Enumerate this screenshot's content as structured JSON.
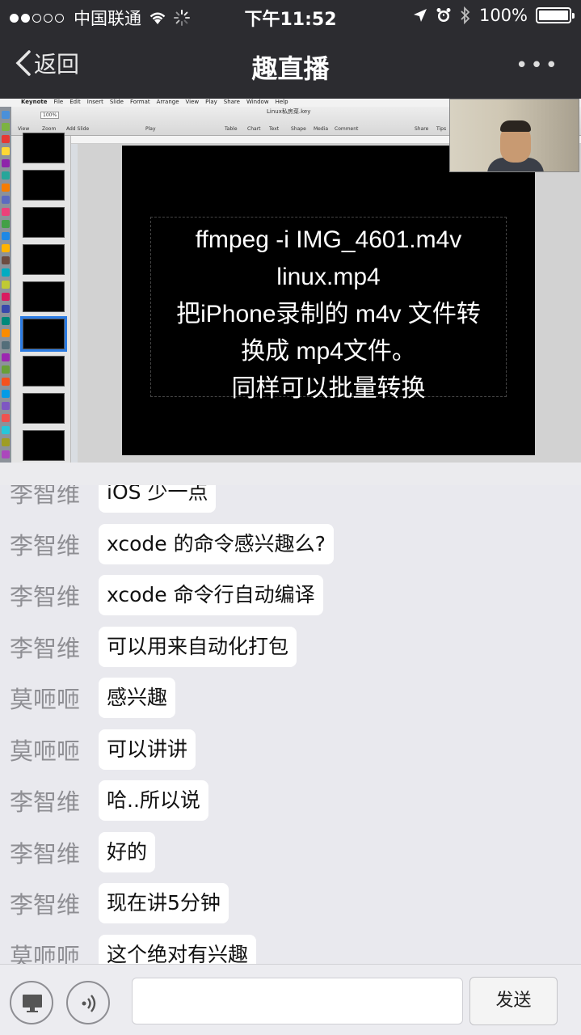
{
  "status_bar": {
    "carrier": "中国联通",
    "time": "下午11:52",
    "battery": "100%",
    "signal_bars_filled": 2,
    "signal_bars_total": 5,
    "battery_level": 1.0
  },
  "nav": {
    "back_label": "返回",
    "title": "趣直播",
    "more": "•••"
  },
  "video": {
    "app_menu": [
      "Keynote",
      "File",
      "Edit",
      "Insert",
      "Slide",
      "Format",
      "Arrange",
      "View",
      "Play",
      "Share",
      "Window",
      "Help"
    ],
    "doc_title": "Linux私房菜.key",
    "toolbar_items": [
      "View",
      "Zoom",
      "Add Slide",
      "Play",
      "Table",
      "Chart",
      "Text",
      "Shape",
      "Media",
      "Comment",
      "Share",
      "Tips"
    ],
    "zoom": "100%",
    "slide_lines": [
      "ffmpeg -i IMG_4601.m4v",
      "linux.mp4",
      "把iPhone录制的 m4v 文件转",
      "换成 mp4文件。",
      "同样可以批量转换"
    ]
  },
  "chat": {
    "messages": [
      {
        "sender": "李智维",
        "text": "iOS 少一点"
      },
      {
        "sender": "李智维",
        "text": "xcode 的命令感兴趣么?"
      },
      {
        "sender": "李智维",
        "text": "xcode 命令行自动编译"
      },
      {
        "sender": "李智维",
        "text": "可以用来自动化打包"
      },
      {
        "sender": "莫咂咂",
        "text": "感兴趣"
      },
      {
        "sender": "莫咂咂",
        "text": "可以讲讲"
      },
      {
        "sender": "李智维",
        "text": "哈..所以说"
      },
      {
        "sender": "李智维",
        "text": "好的"
      },
      {
        "sender": "李智维",
        "text": "现在讲5分钟"
      },
      {
        "sender": "莫咂咂",
        "text": "这个绝对有兴趣"
      }
    ]
  },
  "input_bar": {
    "screen_icon": "monitor-icon",
    "voice_icon": "voice-icon",
    "input_placeholder": "",
    "send_label": "发送"
  },
  "colors": {
    "topbar": "#2c2c30",
    "chat_bg": "#e9e9ee",
    "bubble": "#ffffff",
    "sender": "#8e8e93",
    "slide_selected": "#2a7be3"
  }
}
